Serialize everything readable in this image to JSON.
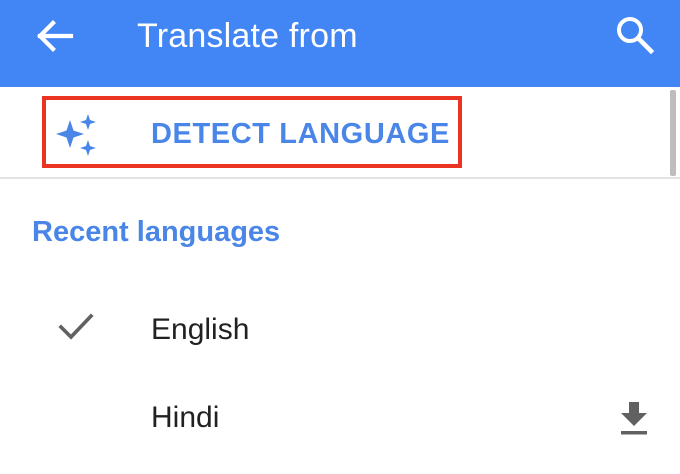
{
  "app_bar": {
    "title": "Translate from",
    "back_icon": "arrow-back-icon",
    "search_icon": "search-icon",
    "background_color": "#4285f4"
  },
  "detect": {
    "label": "DETECT LANGUAGE",
    "icon": "sparkle-icon",
    "highlight_color": "#ea3323"
  },
  "recent": {
    "heading": "Recent languages",
    "languages": [
      {
        "label": "English",
        "selected": true,
        "status_icon": "check-icon"
      },
      {
        "label": "Hindi",
        "selected": false,
        "action_icon": "download-icon"
      }
    ]
  },
  "colors": {
    "accent": "#4a86e8",
    "text": "#212121",
    "icon_gray": "#616161"
  }
}
